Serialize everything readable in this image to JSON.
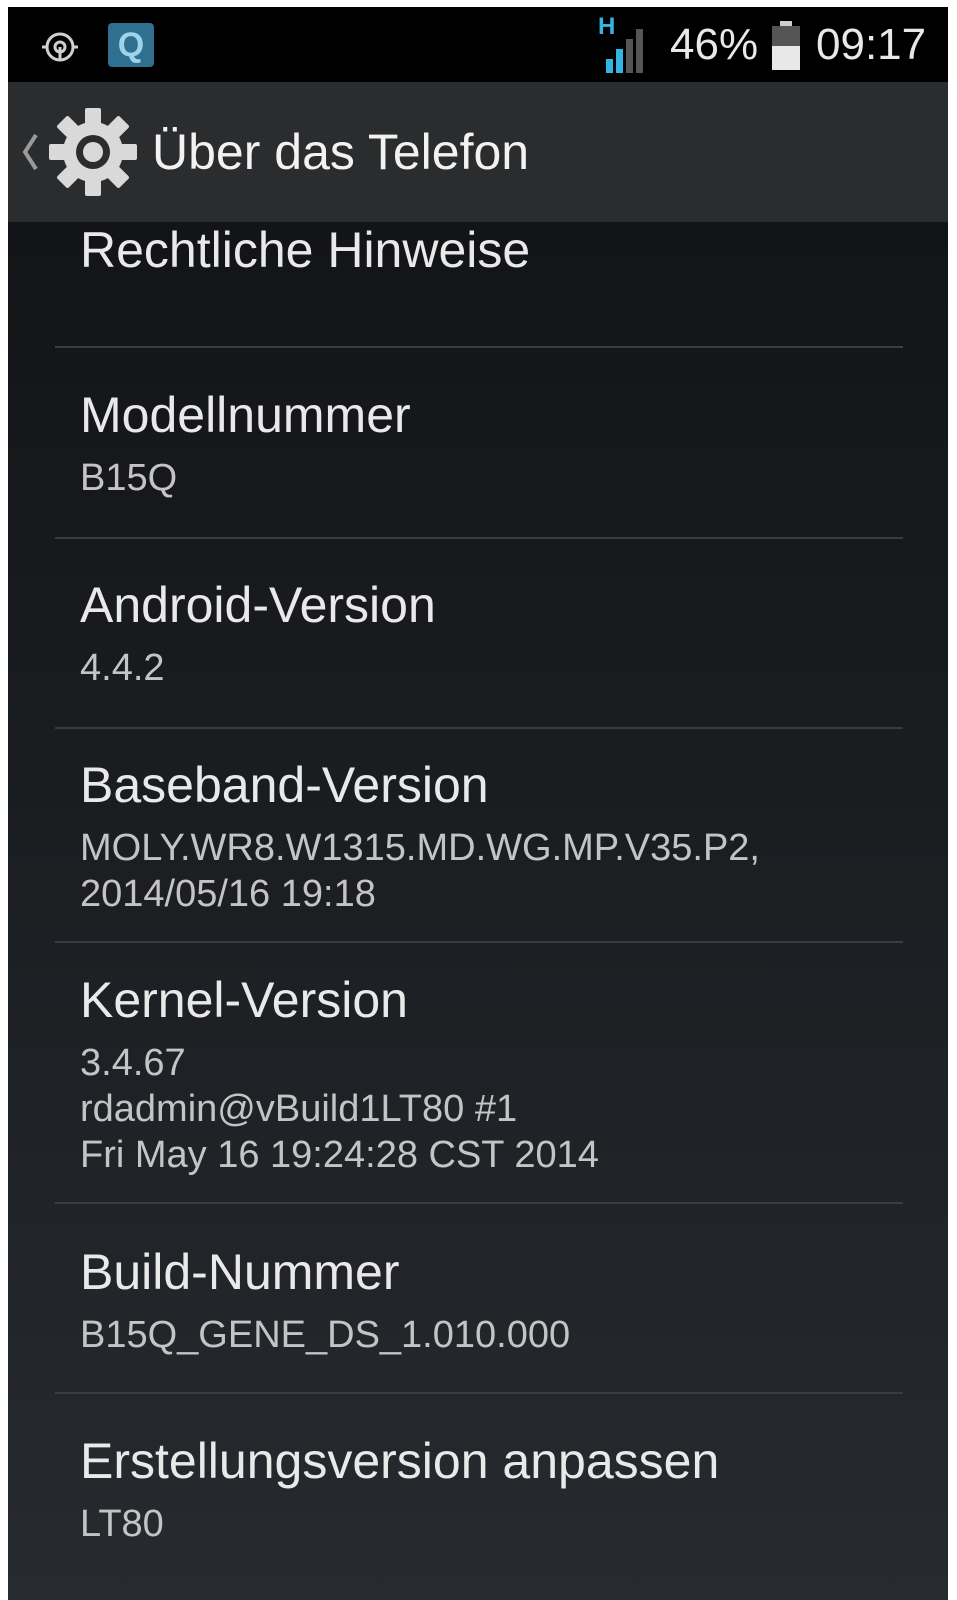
{
  "status_bar": {
    "notification_icons": [
      "sync-icon",
      "q-app-icon"
    ],
    "q_icon_label": "Q",
    "network_type": "H",
    "battery_percent": "46%",
    "time": "09:17"
  },
  "action_bar": {
    "icon": "gear-icon",
    "title": "Über das Telefon"
  },
  "items": [
    {
      "title": "Rechtliche Hinweise",
      "summary": ""
    },
    {
      "title": "Modellnummer",
      "summary": "B15Q"
    },
    {
      "title": "Android-Version",
      "summary": "4.4.2"
    },
    {
      "title": "Baseband-Version",
      "summary": "MOLY.WR8.W1315.MD.WG.MP.V35.P2,\n2014/05/16 19:18"
    },
    {
      "title": "Kernel-Version",
      "summary": "3.4.67\nrdadmin@vBuild1LT80 #1\nFri May 16 19:24:28 CST 2014"
    },
    {
      "title": "Build-Nummer",
      "summary": "B15Q_GENE_DS_1.010.000"
    },
    {
      "title": "Erstellungsversion anpassen",
      "summary": "LT80"
    }
  ],
  "colors": {
    "status_bar_bg": "#000000",
    "action_bar_bg": "#2b2c2e",
    "title_text": "#e9e9e9",
    "summary_text": "#c4c4c4",
    "network_accent": "#33b5e5"
  }
}
